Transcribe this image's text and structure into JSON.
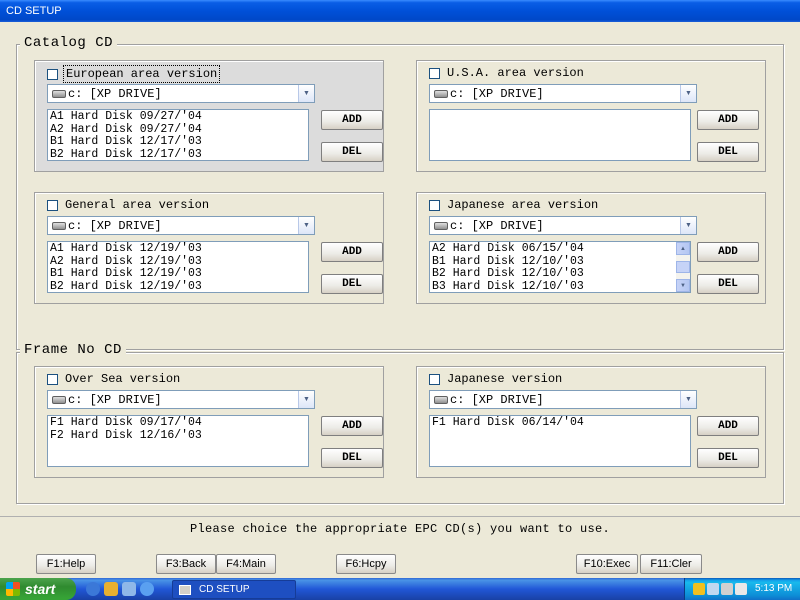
{
  "window": {
    "title": "CD SETUP"
  },
  "catalog": {
    "title": "Catalog  CD",
    "panels": [
      {
        "label": "European area version",
        "drive": "c: [XP DRIVE]",
        "items": [
          "A1 Hard Disk 09/27/'04",
          "A2 Hard Disk 09/27/'04",
          "B1 Hard Disk 12/17/'03",
          "B2 Hard Disk 12/17/'03"
        ]
      },
      {
        "label": "U.S.A. area version",
        "drive": "c: [XP DRIVE]",
        "items": []
      },
      {
        "label": "General area version",
        "drive": "c: [XP DRIVE]",
        "items": [
          "A1 Hard Disk 12/19/'03",
          "A2 Hard Disk 12/19/'03",
          "B1 Hard Disk 12/19/'03",
          "B2 Hard Disk 12/19/'03"
        ]
      },
      {
        "label": "Japanese area version",
        "drive": "c: [XP DRIVE]",
        "items": [
          "A2 Hard Disk 06/15/'04",
          "B1 Hard Disk 12/10/'03",
          "B2 Hard Disk 12/10/'03",
          "B3 Hard Disk 12/10/'03"
        ]
      }
    ]
  },
  "frame": {
    "title": "Frame No CD",
    "panels": [
      {
        "label": "Over Sea version",
        "drive": "c: [XP DRIVE]",
        "items": [
          "F1 Hard Disk 09/17/'04",
          "F2 Hard Disk 12/16/'03"
        ]
      },
      {
        "label": "Japanese version",
        "drive": "c: [XP DRIVE]",
        "items": [
          "F1 Hard Disk 06/14/'04"
        ]
      }
    ]
  },
  "buttons": {
    "add": "ADD",
    "del": "DEL"
  },
  "message": "Please choice the appropriate EPC CD(s) you want to use.",
  "fkeys": [
    "F1:Help",
    "F3:Back",
    "F4:Main",
    "F6:Hcpy",
    "F10:Exec",
    "F11:Cler"
  ],
  "taskbar": {
    "start": "start",
    "task": "CD SETUP",
    "clock": "5:13 PM"
  }
}
